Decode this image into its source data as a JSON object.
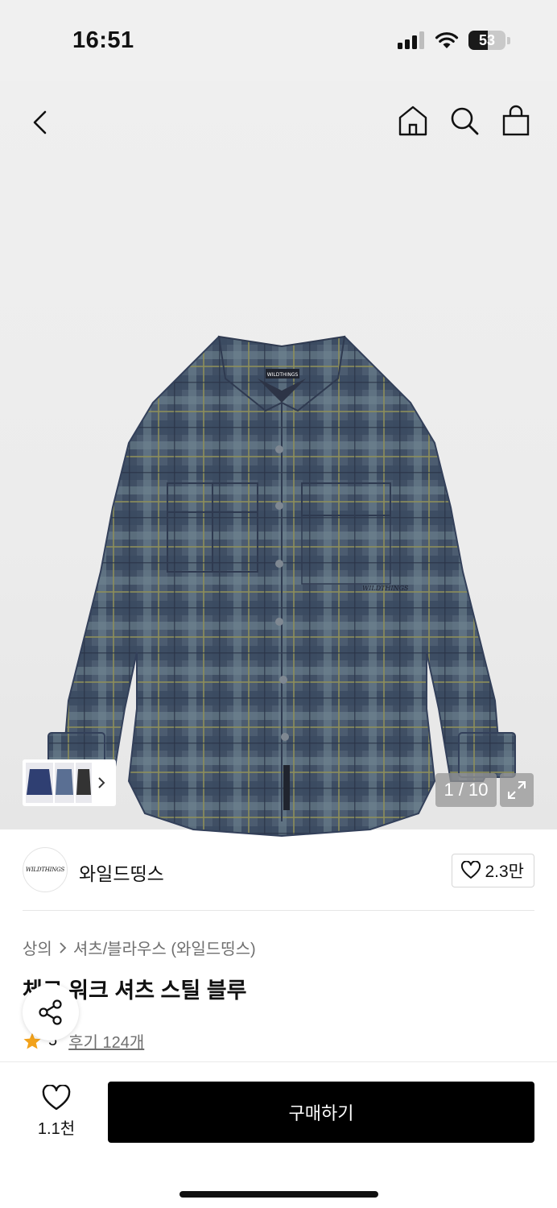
{
  "status_bar": {
    "time": "16:51",
    "battery_level": "53",
    "battery_fraction": 0.53,
    "icons": [
      "signal-icon",
      "wifi-icon",
      "battery-icon"
    ]
  },
  "nav": {
    "back_icon": "chevron-left-icon",
    "right_icons": [
      "home-icon",
      "search-icon",
      "shopping-bag-icon"
    ]
  },
  "gallery": {
    "pager": "1 / 10",
    "current_image": 1,
    "total_images": 10,
    "product_image": "plaid-shirt-photo",
    "logo_text": "WILDTHINGS",
    "thumbnail_colors": [
      "#2f3f72",
      "#5a6f93",
      "#333333"
    ]
  },
  "brand": {
    "logo_text": "WILDTHINGS",
    "name": "와일드띵스",
    "like_count": "2.3만"
  },
  "product": {
    "breadcrumb": [
      "상의",
      "셔츠/블라우스 (와일드띵스)"
    ],
    "title": "체크 워크 셔츠 스틸 블루",
    "rating": "5",
    "reviews": "후기 124개"
  },
  "bottom_bar": {
    "wish_count": "1.1천",
    "buy_label": "구매하기"
  },
  "colors": {
    "accent": "#000000",
    "star": "#f2a21b",
    "muted_text": "#6f6f6f"
  }
}
